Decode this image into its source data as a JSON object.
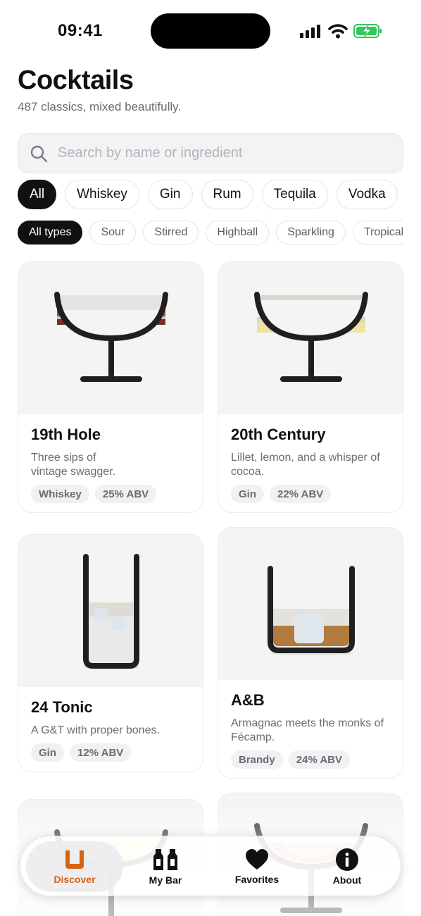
{
  "status_bar": {
    "time": "09:41",
    "icons": [
      "signal-icon",
      "wifi-icon",
      "battery-charging-icon"
    ]
  },
  "header": {
    "title": "Cocktails",
    "subtitle": "487 classics, mixed beautifully."
  },
  "search": {
    "placeholder": "Search by name or ingredient",
    "icon": "search-icon"
  },
  "spirit_filters": [
    "All",
    "Whiskey",
    "Gin",
    "Rum",
    "Tequila",
    "Vodka"
  ],
  "type_filters": [
    "All types",
    "Sour",
    "Stirred",
    "Highball",
    "Sparkling",
    "Tropical"
  ],
  "cocktails": [
    {
      "name": "19th Hole",
      "description": "Three sips of vintage swagger.",
      "spirit": "Whiskey",
      "abv": "25% ABV",
      "glass": "coupe-glass-icon"
    },
    {
      "name": "20th Century",
      "description": "Lillet, lemon, and a whisper of cocoa.",
      "spirit": "Gin",
      "abv": "22% ABV",
      "glass": "coupe-glass-icon"
    },
    {
      "name": "24 Tonic",
      "description": "A G&T with proper bones.",
      "spirit": "Gin",
      "abv": "12% ABV",
      "glass": "highball-glass-icon"
    },
    {
      "name": "A&B",
      "description": "Armagnac meets the monks of Fécamp.",
      "spirit": "Brandy",
      "abv": "24% ABV",
      "glass": "rocks-glass-icon"
    }
  ],
  "tab_bar": {
    "tabs": [
      {
        "label": "Discover",
        "icon": "cup-icon",
        "active": true
      },
      {
        "label": "My Bar",
        "icon": "bottles-icon",
        "active": false
      },
      {
        "label": "Favorites",
        "icon": "heart-icon",
        "active": false
      },
      {
        "label": "About",
        "icon": "info-icon",
        "active": false
      }
    ]
  },
  "colors": {
    "accent": "#d9640f",
    "chip_active": "#111111",
    "text_secondary": "#6b6b72",
    "card_image_bg": "#f4f4f5"
  }
}
